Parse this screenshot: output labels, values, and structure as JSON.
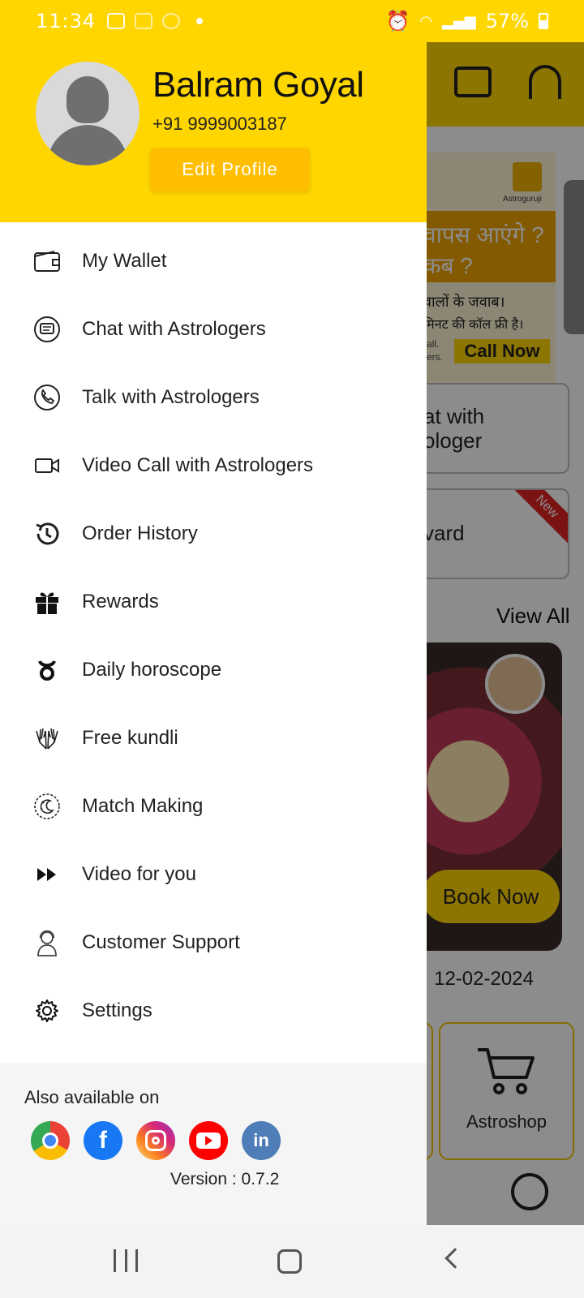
{
  "status_bar": {
    "time": "11:34",
    "battery": "57%"
  },
  "background_app": {
    "banner_line1": "वापस आएंगे ?",
    "banner_line2": "कब ?",
    "banner_line3": "वालों के जवाब।",
    "banner_line4": "मिनट की कॉल फ्री है।",
    "banner_small": "call.\nsers.",
    "banner_logo": "Astroguruji",
    "banner_cta": "Call Now",
    "card1_text": "at with\nologer",
    "card2_text": "vard",
    "new_badge": "New",
    "view_all": "View All",
    "video_cta": "Book Now",
    "video_date": "12-02-2024",
    "tile_label": "Astroshop"
  },
  "drawer": {
    "user_name": "Balram Goyal",
    "phone": "+91 9999003187",
    "edit_label": "Edit Profile",
    "menu": [
      {
        "label": "My Wallet",
        "icon": "wallet-icon"
      },
      {
        "label": "Chat with Astrologers",
        "icon": "chat-icon"
      },
      {
        "label": "Talk with Astrologers",
        "icon": "phone-icon"
      },
      {
        "label": "Video Call with Astrologers",
        "icon": "video-icon"
      },
      {
        "label": "Order History",
        "icon": "history-icon"
      },
      {
        "label": "Rewards",
        "icon": "gift-icon"
      },
      {
        "label": "Daily horoscope",
        "icon": "taurus-icon"
      },
      {
        "label": "Free kundli",
        "icon": "praying-hands-icon"
      },
      {
        "label": "Match Making",
        "icon": "moon-stars-icon"
      },
      {
        "label": "Video for you",
        "icon": "fast-forward-icon"
      },
      {
        "label": "Customer Support",
        "icon": "support-agent-icon"
      },
      {
        "label": "Settings",
        "icon": "gear-icon"
      }
    ],
    "also_available": "Also available on",
    "social": [
      {
        "name": "chrome",
        "color": "#4285f4"
      },
      {
        "name": "facebook",
        "label": "f",
        "color": "#1877f2"
      },
      {
        "name": "instagram",
        "color": "#d62976"
      },
      {
        "name": "youtube",
        "color": "#ff0000"
      },
      {
        "name": "linkedin",
        "label": "in",
        "color": "#4f7db8"
      }
    ],
    "version": "Version : 0.7.2"
  },
  "colors": {
    "accent": "#ffd600",
    "edit_button": "#ffbf00"
  }
}
